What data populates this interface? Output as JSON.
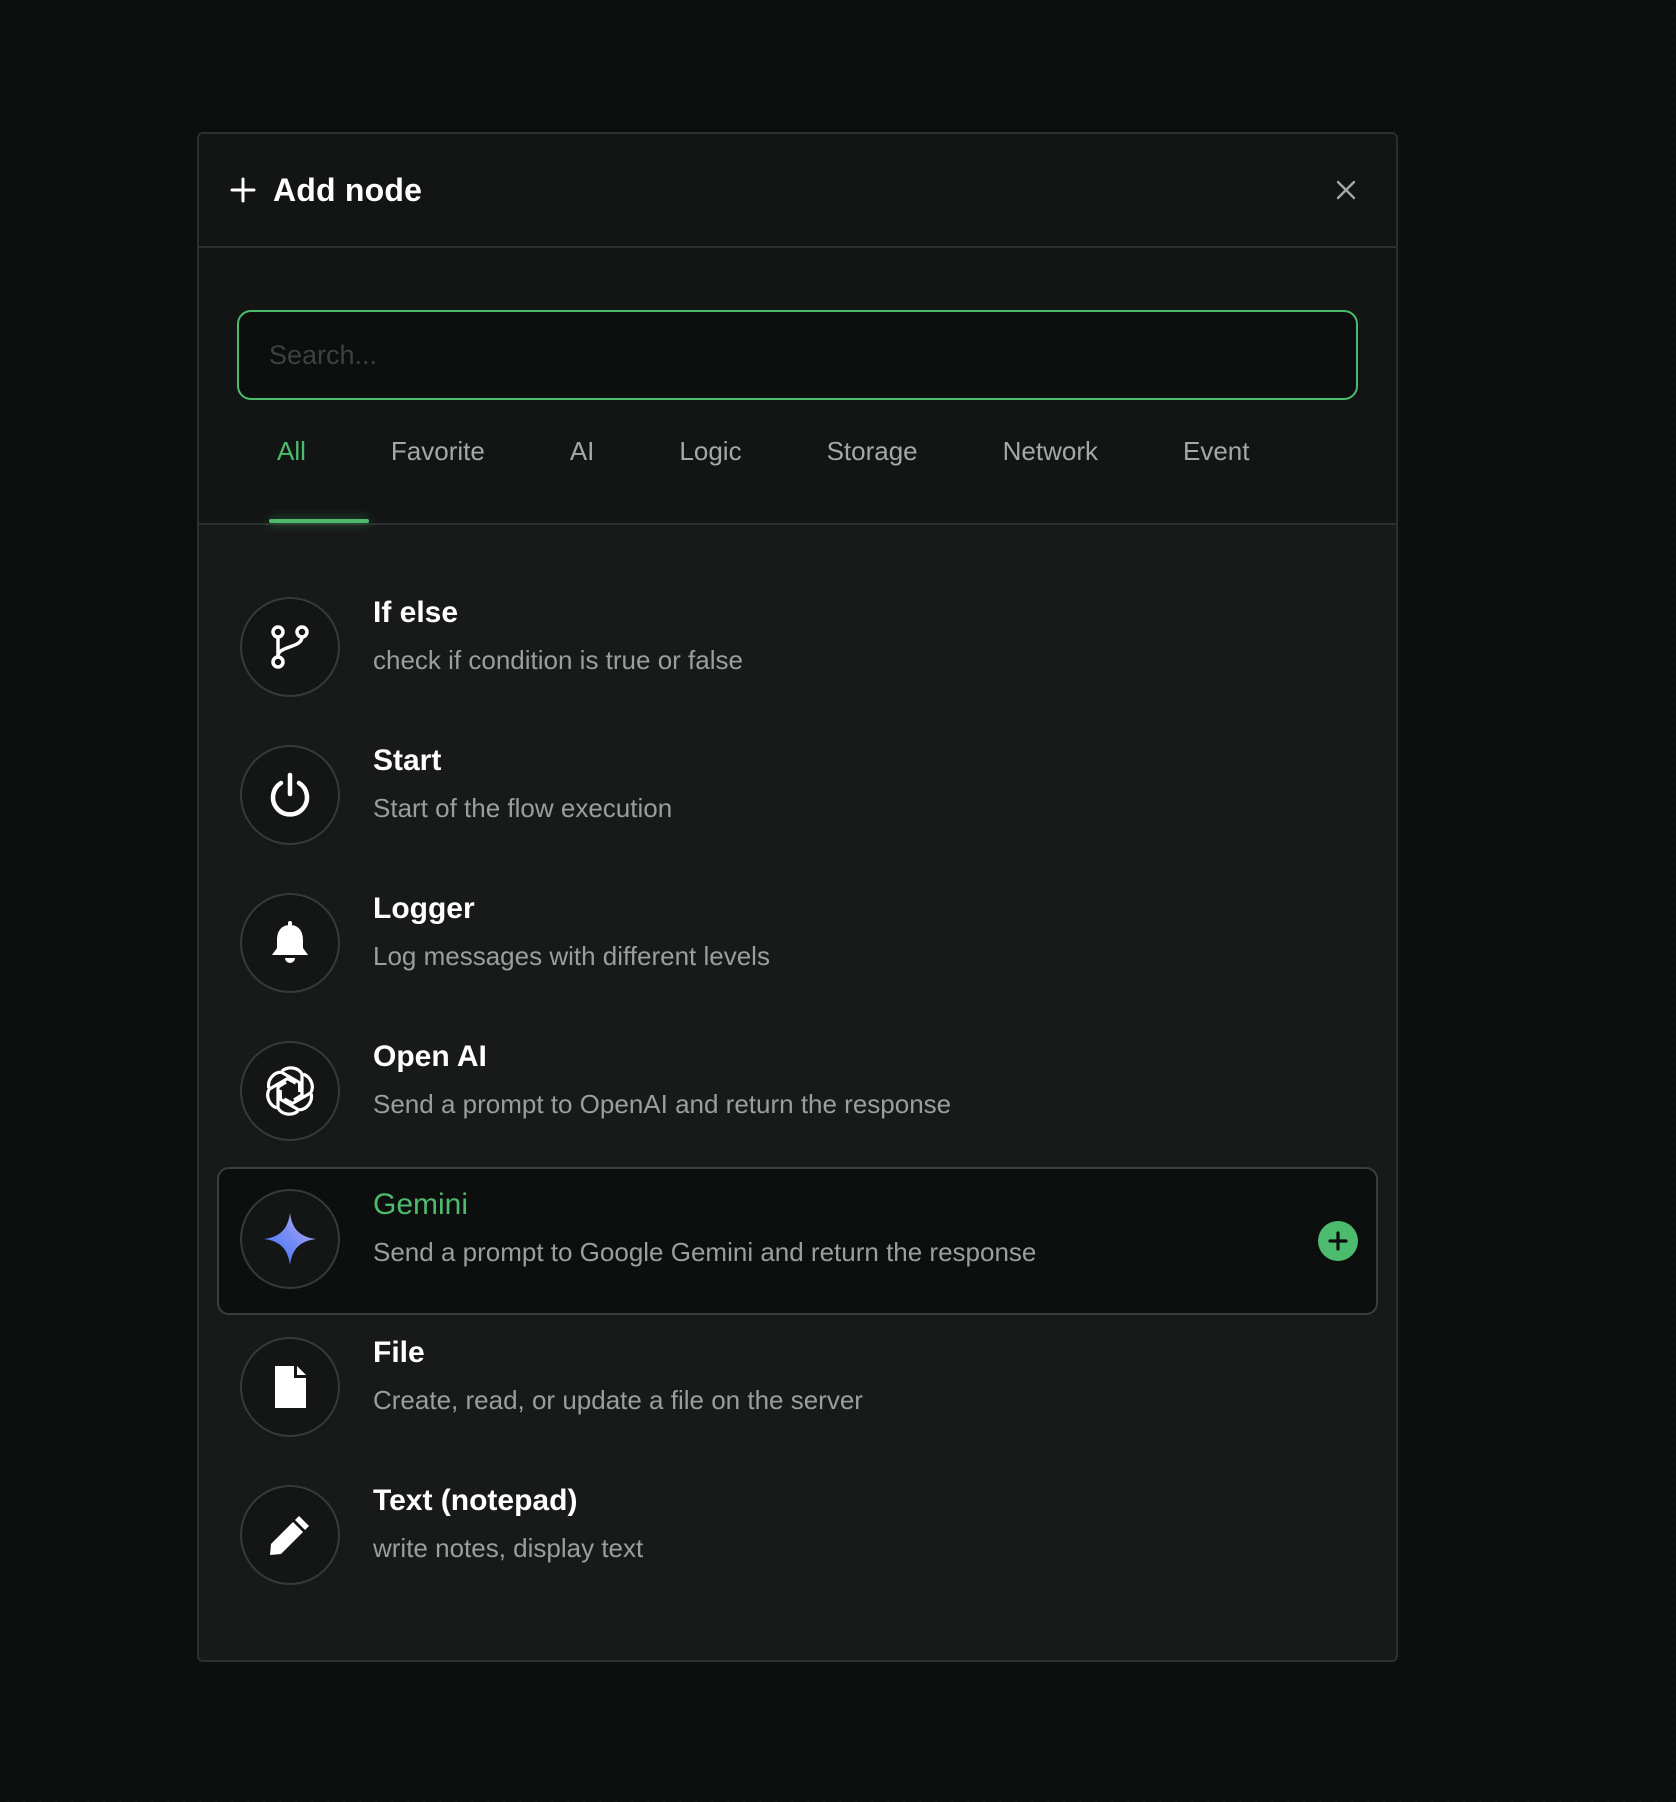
{
  "dialog": {
    "title": "Add node",
    "search_placeholder": "Search..."
  },
  "tabs": [
    {
      "label": "All",
      "active": true
    },
    {
      "label": "Favorite"
    },
    {
      "label": "AI"
    },
    {
      "label": "Logic"
    },
    {
      "label": "Storage"
    },
    {
      "label": "Network"
    },
    {
      "label": "Event"
    }
  ],
  "nodes": [
    {
      "name": "If else",
      "description": "check if condition is true or false",
      "icon": "git-branch-icon"
    },
    {
      "name": "Start",
      "description": "Start of the flow execution",
      "icon": "power-icon"
    },
    {
      "name": "Logger",
      "description": "Log messages with different levels",
      "icon": "bell-icon"
    },
    {
      "name": "Open AI",
      "description": "Send a prompt to OpenAI and return the response",
      "icon": "openai-icon"
    },
    {
      "name": "Gemini",
      "description": "Send a prompt to Google Gemini and return the response",
      "icon": "gemini-sparkle-icon",
      "highlighted": true
    },
    {
      "name": "File",
      "description": "Create, read, or update a file on the server",
      "icon": "file-icon"
    },
    {
      "name": "Text (notepad)",
      "description": "write notes, display text",
      "icon": "pencil-icon"
    }
  ],
  "colors": {
    "accent": "#4cbb6e",
    "panel_bg": "#181a1a",
    "page_bg": "#0d0e0e"
  }
}
